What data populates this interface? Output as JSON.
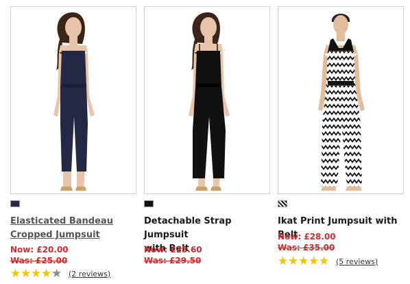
{
  "products": [
    {
      "name": "Elasticated Bandeau Cropped Jumpsuit",
      "name_line1": "Elasticated Bandeau",
      "name_line2": "Cropped Jumpsuit",
      "now_price": "Now: £20.00",
      "was_price": "Was: £25.00",
      "rating": 4,
      "max_rating": 5,
      "reviews": "(2 reviews)",
      "swatch_color": "#242a44",
      "image_icon": "model-navy-bandeau-jumpsuit"
    },
    {
      "name": "Detachable Strap Jumpsuit with Belt",
      "name_line1": "Detachable Strap Jumpsuit",
      "name_line2": "with Belt",
      "now_price": "Now: £23.60",
      "was_price": "Was: £29.50",
      "swatch_color": "#111111",
      "image_icon": "model-black-strap-jumpsuit"
    },
    {
      "name": "Ikat Print Jumpsuit with Belt",
      "name_line1": "Ikat Print Jumpsuit with Belt",
      "now_price": "Now: £28.00",
      "was_price": "Was: £35.00",
      "rating": 5,
      "max_rating": 5,
      "reviews": "(5 reviews)",
      "swatch_color": "ikat-print",
      "image_icon": "model-ikat-print-jumpsuit"
    }
  ],
  "colors": {
    "price_red": "#d9272e",
    "star_gold": "#f2c500",
    "star_grey": "#8a8a8a",
    "border": "#cfcfcf"
  }
}
